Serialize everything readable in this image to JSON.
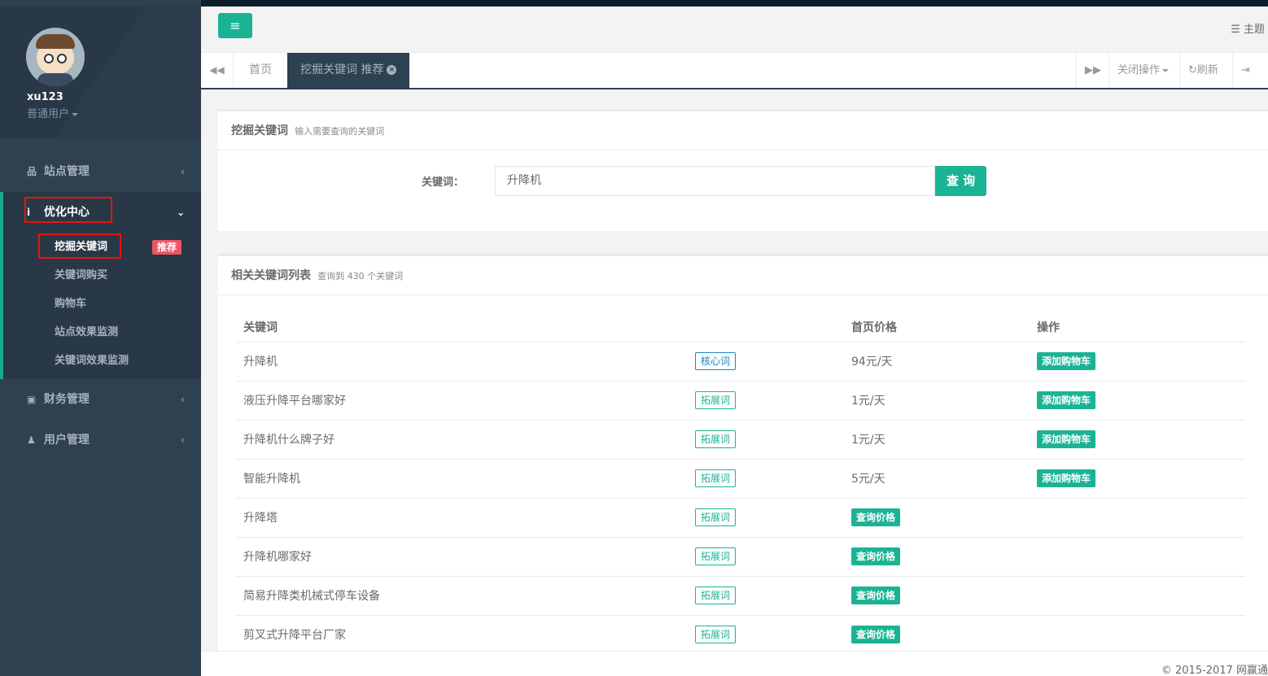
{
  "user": {
    "name": "xu123",
    "role": "普通用户"
  },
  "sidebar": {
    "items": [
      {
        "icon": "sitemap-icon",
        "glyph": "品",
        "label": "站点管理"
      },
      {
        "icon": "info-icon",
        "glyph": "i",
        "label": "优化中心"
      },
      {
        "icon": "money-icon",
        "glyph": "▣",
        "label": "财务管理"
      },
      {
        "icon": "user-icon",
        "glyph": "♟",
        "label": "用户管理"
      }
    ],
    "submenu": [
      {
        "label": "挖掘关键词",
        "badge": "推荐"
      },
      {
        "label": "关键词购买"
      },
      {
        "label": "购物车"
      },
      {
        "label": "站点效果监测"
      },
      {
        "label": "关键词效果监测"
      }
    ]
  },
  "topbar": {
    "theme_label": "主题"
  },
  "tabs": {
    "home": "首页",
    "active": "挖掘关键词 推荐",
    "close_ops": "关闭操作",
    "refresh": "刷新",
    "logout": "退"
  },
  "search_panel": {
    "title": "挖掘关键词",
    "subtitle": "输入需要查询的关键词",
    "field_label": "关键词：",
    "field_value": "升降机",
    "button": "查 询"
  },
  "results_panel": {
    "title": "相关关键词列表",
    "subtitle": "查询到 430 个关键词",
    "headers": [
      "关键词",
      "",
      "首页价格",
      "操作"
    ],
    "rows": [
      {
        "keyword": "升降机",
        "tag": "核心词",
        "tag_type": "core",
        "price": "94元/天",
        "price_button": "",
        "action": "添加购物车"
      },
      {
        "keyword": "液压升降平台哪家好",
        "tag": "拓展词",
        "tag_type": "ext",
        "price": "1元/天",
        "price_button": "",
        "action": "添加购物车"
      },
      {
        "keyword": "升降机什么牌子好",
        "tag": "拓展词",
        "tag_type": "ext",
        "price": "1元/天",
        "price_button": "",
        "action": "添加购物车"
      },
      {
        "keyword": "智能升降机",
        "tag": "拓展词",
        "tag_type": "ext",
        "price": "5元/天",
        "price_button": "",
        "action": "添加购物车"
      },
      {
        "keyword": "升降塔",
        "tag": "拓展词",
        "tag_type": "ext",
        "price": "",
        "price_button": "查询价格",
        "action": ""
      },
      {
        "keyword": "升降机哪家好",
        "tag": "拓展词",
        "tag_type": "ext",
        "price": "",
        "price_button": "查询价格",
        "action": ""
      },
      {
        "keyword": "简易升降类机械式停车设备",
        "tag": "拓展词",
        "tag_type": "ext",
        "price": "",
        "price_button": "查询价格",
        "action": ""
      },
      {
        "keyword": "剪叉式升降平台厂家",
        "tag": "拓展词",
        "tag_type": "ext",
        "price": "",
        "price_button": "查询价格",
        "action": ""
      }
    ]
  },
  "footer": {
    "copyright": "© 2015-2017 网赢通"
  },
  "colors": {
    "accent": "#1ab394",
    "sidebar": "#2f4050",
    "badge": "#ed5565",
    "core_tag": "#1c84c6",
    "highlight": "#ee1111"
  }
}
